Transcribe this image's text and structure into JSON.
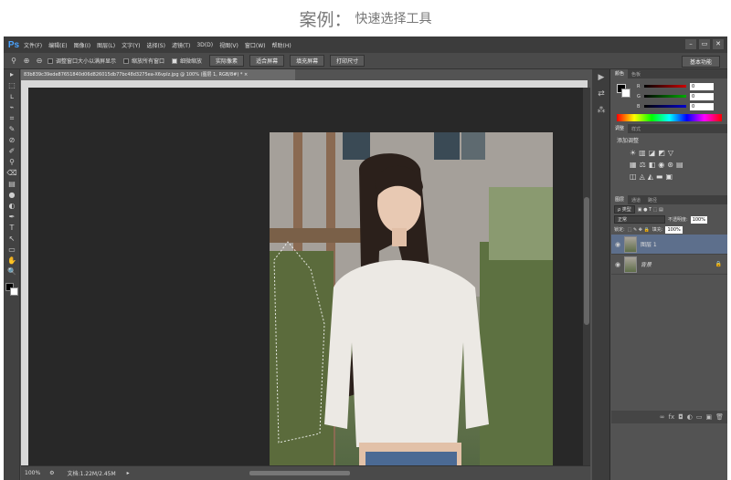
{
  "header": {
    "title": "案例",
    "colon": "：",
    "subtitle": "快速选择工具"
  },
  "app": {
    "logo": "Ps"
  },
  "menu": [
    "文件(F)",
    "编辑(E)",
    "图像(I)",
    "图层(L)",
    "文字(Y)",
    "选择(S)",
    "滤镜(T)",
    "3D(D)",
    "视图(V)",
    "窗口(W)",
    "帮助(H)"
  ],
  "window_controls": [
    "–",
    "▭",
    "✕"
  ],
  "options": {
    "resize_windows": "调整窗口大小以满屏显示",
    "zoom_all": "缩放所有窗口",
    "scrubby_zoom": "细微缩放",
    "btn_actual": "实际像素",
    "btn_fit": "适合屏幕",
    "btn_fill": "填充屏幕",
    "btn_print": "打印尺寸",
    "workspace": "基本功能"
  },
  "document": {
    "tab_title": "83b839c39ede87651840d06d826015db77bc48d3275ea-X6vpIz.jpg @ 100% (图层 1, RGB/8#) * ×"
  },
  "status": {
    "zoom": "100%",
    "doc_info": "文档:1.22M/2.45M"
  },
  "tools": [
    "▸",
    "⬚",
    "ʟ",
    "⌁",
    "⌗",
    "✎",
    "⊘",
    "✐",
    "⚲",
    "⌫",
    "▤",
    "●",
    "◐",
    "✒",
    "T",
    "↖",
    "▭",
    "✋",
    "🔍"
  ],
  "icon_strip": [
    "▶",
    "⇄",
    "⁂"
  ],
  "color_panel": {
    "tabs": [
      "颜色",
      "色板"
    ],
    "r_label": "R",
    "g_label": "G",
    "b_label": "B",
    "r_value": "0",
    "g_value": "0",
    "b_value": "0",
    "colors": {
      "r": "#cc0000",
      "g": "#00aa00",
      "b": "#0000cc"
    }
  },
  "adjustments": {
    "tabs": [
      "调整",
      "样式"
    ],
    "title": "添加调整"
  },
  "layers_panel": {
    "tabs": [
      "图层",
      "通道",
      "路径"
    ],
    "kind_filter": "ρ 类型",
    "blend_mode": "正常",
    "opacity_label": "不透明度:",
    "opacity_value": "100%",
    "lock_label": "锁定:",
    "fill_label": "填充:",
    "fill_value": "100%",
    "layers": [
      {
        "name": "图层 1",
        "selected": true
      },
      {
        "name": "背景",
        "selected": false
      }
    ]
  }
}
